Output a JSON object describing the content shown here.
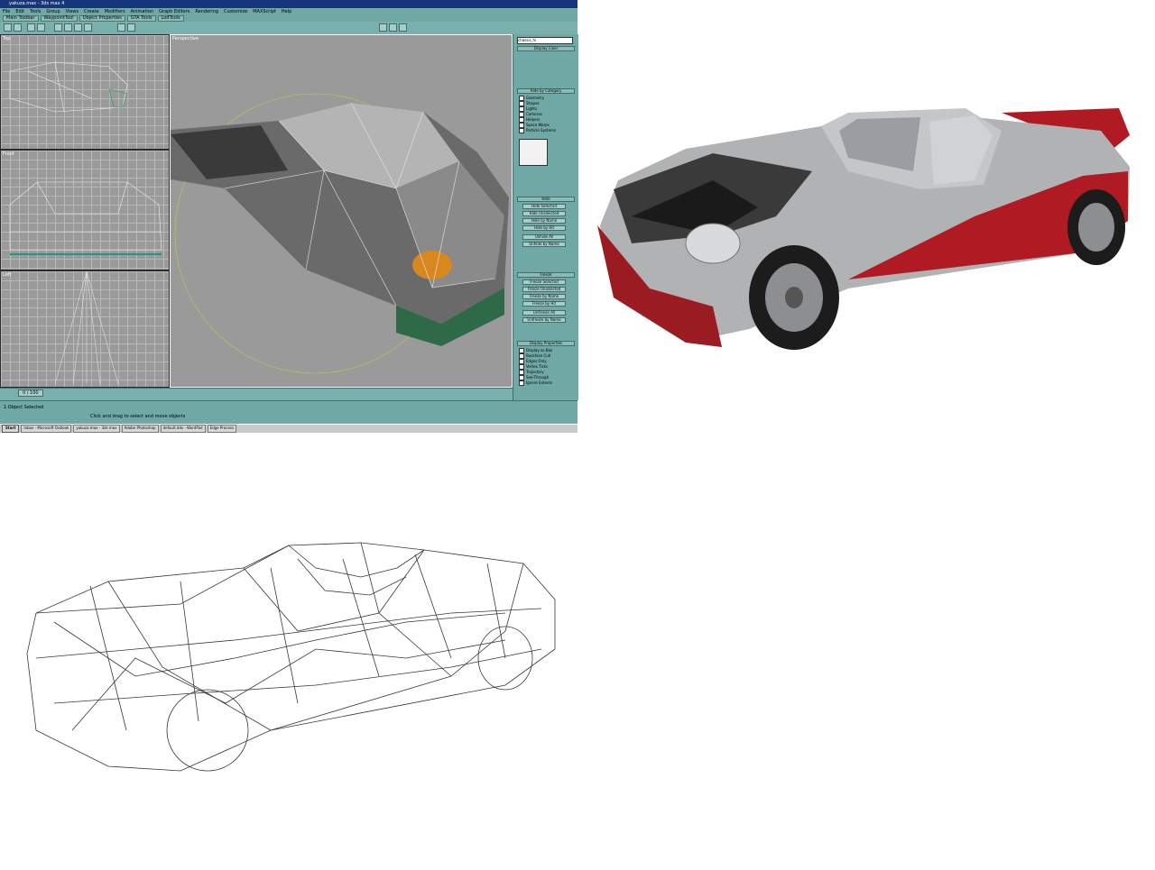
{
  "scene": {
    "car_colors": {
      "body": "#b4b6b8",
      "accent": "#b01a22",
      "tire": "#1c1c1c",
      "wireframe": "#3a3440"
    }
  },
  "max_window": {
    "title": "yakuza.max - 3ds max 4",
    "menu": [
      "File",
      "Edit",
      "Tools",
      "Group",
      "Views",
      "Create",
      "Modifiers",
      "Animation",
      "Graph Editors",
      "Rendering",
      "Customize",
      "MAXScript",
      "Help"
    ],
    "tabs": [
      "Main Toolbar",
      "WaypointTool",
      "Object Properties",
      "GTA Tools",
      "LodTools"
    ],
    "viewport_labels": [
      "Top",
      "Front",
      "Left",
      "Perspective"
    ],
    "object_name": "chassis_hi",
    "rollouts": {
      "display_color": "Display Color",
      "hide_by_category": "Hide by Category",
      "hide": "Hide",
      "freeze": "Freeze",
      "display_properties": "Display Properties"
    },
    "category_items": [
      "Geometry",
      "Shapes",
      "Lights",
      "Cameras",
      "Helpers",
      "Space Warps",
      "Particle Systems"
    ],
    "hide_buttons": [
      "Hide Selected",
      "Hide Unselected",
      "Hide by Name",
      "Hide by Hit",
      "Unhide All",
      "Unhide by Name"
    ],
    "freeze_buttons": [
      "Freeze Selected",
      "Freeze Unselected",
      "Freeze by Name",
      "Freeze by Hit",
      "Unfreeze All",
      "Unfreeze by Name"
    ],
    "display_props": [
      "Display as Box",
      "Backface Cull",
      "Edges Only",
      "Vertex Ticks",
      "Trajectory",
      "See-Through",
      "Ignore Extents"
    ],
    "timeline": "0 / 100",
    "status_left": "1 Object Selected",
    "status_prompt": "Click and drag to select and move objects",
    "taskbar": [
      "Start",
      "Inbox - Microsoft Outlook",
      "yakuza.max - 3ds max",
      "Adobe Photoshop",
      "default.dds - WordPad",
      "Edge Process"
    ]
  }
}
